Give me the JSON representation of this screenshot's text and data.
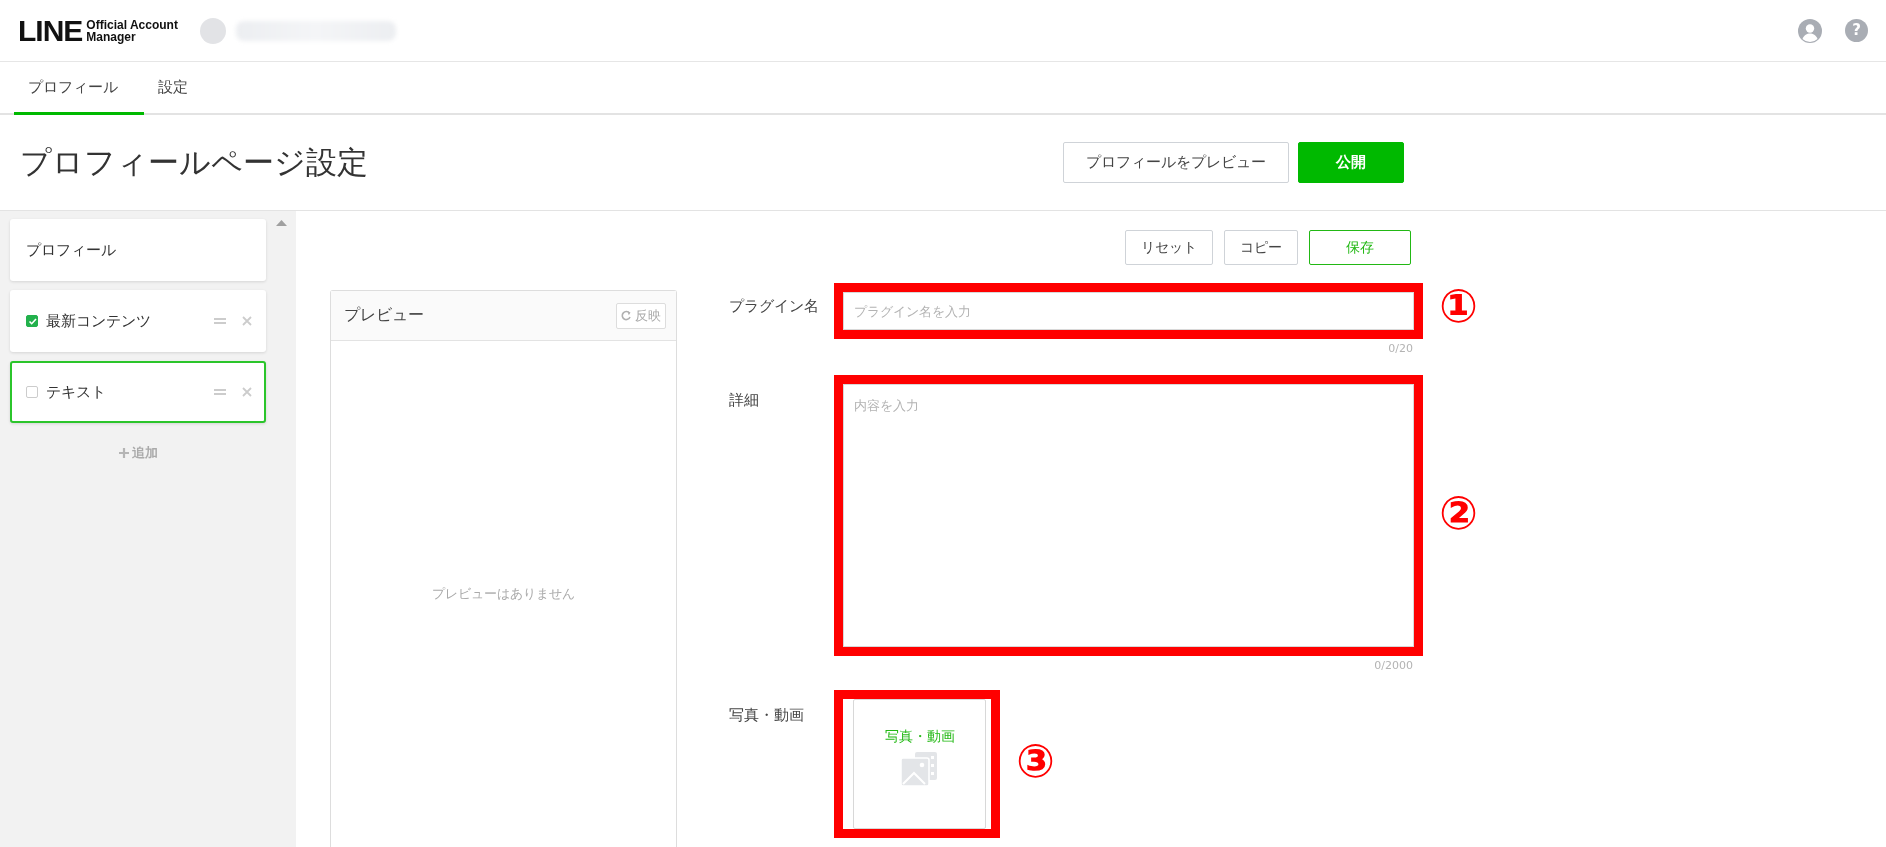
{
  "header": {
    "logo": {
      "wordmark": "LINE",
      "subtitle_lines": [
        "Official Account",
        "Manager"
      ]
    },
    "help_label": "?"
  },
  "tabs": [
    {
      "label": "プロフィール",
      "selected": true
    },
    {
      "label": "設定",
      "selected": false
    }
  ],
  "page": {
    "title": "プロフィールページ設定",
    "buttons": [
      {
        "label": "プロフィールをプレビュー",
        "kind": "secondary"
      },
      {
        "label": "公開",
        "kind": "primary"
      }
    ]
  },
  "sidebar": {
    "items": [
      {
        "label": "プロフィール",
        "kind": "fixed",
        "selected": false
      },
      {
        "label": "最新コンテンツ",
        "kind": "plugin",
        "checked": true,
        "selected": false
      },
      {
        "label": "テキスト",
        "kind": "plugin",
        "checked": false,
        "selected": true
      }
    ],
    "add_label": "追加"
  },
  "editor": {
    "actions": [
      {
        "label": "リセット",
        "kind": "default"
      },
      {
        "label": "コピー",
        "kind": "default"
      },
      {
        "label": "保存",
        "kind": "primary"
      }
    ],
    "preview": {
      "title": "プレビュー",
      "reflect_label": "反映",
      "empty_text": "プレビューはありません"
    },
    "fields": [
      {
        "kind": "text",
        "label": "プラグイン名",
        "placeholder": "プラグイン名を入力",
        "counter": "0/20",
        "highlighted": true,
        "annotation": "①"
      },
      {
        "kind": "textarea",
        "label": "詳細",
        "placeholder": "内容を入力",
        "counter": "0/2000",
        "highlighted": true,
        "annotation": "②"
      },
      {
        "kind": "media",
        "label": "写真・動画",
        "tile_label": "写真・動画",
        "highlighted": true,
        "annotation": "③"
      }
    ]
  }
}
